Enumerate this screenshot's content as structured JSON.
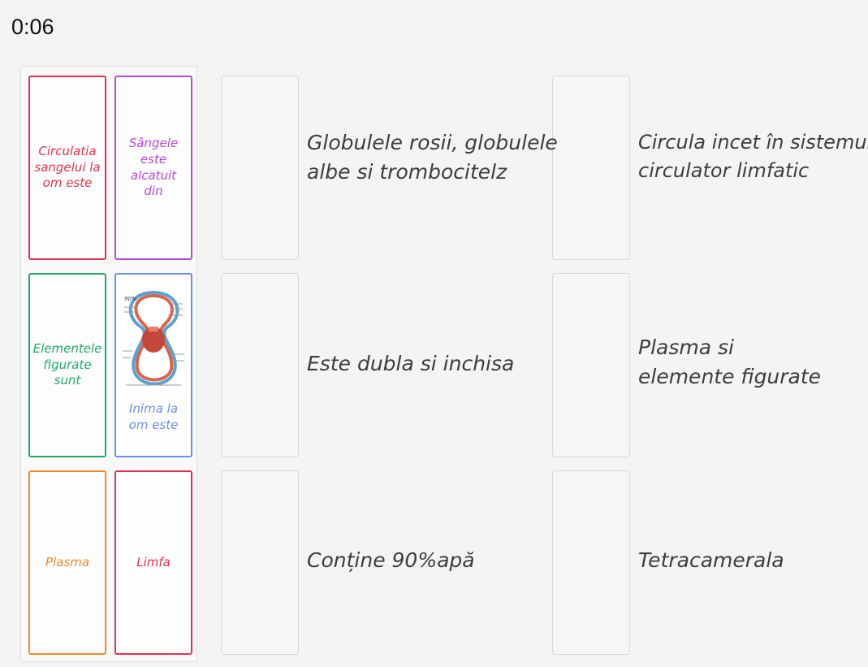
{
  "timer": "0:06",
  "cards": [
    {
      "label": "Circulatia sangelui la om este",
      "color": "#e0334f"
    },
    {
      "label": "Sângele este alcatuit din",
      "color": "#b54ad9"
    },
    {
      "label": "Elementele figurate sunt",
      "color": "#22a86b"
    },
    {
      "label": "Inima la om este",
      "color": "#6c8ee6",
      "image": "heart-circulation-diagram"
    },
    {
      "label": "Plasma",
      "color": "#f28a2c"
    },
    {
      "label": "Limfa",
      "color": "#e0334f"
    }
  ],
  "targets": [
    {
      "line1": "Globulele rosii, globulele",
      "line2": "albe si trombocitelz"
    },
    {
      "line1": "Circula incet în sistemul",
      "line2": "circulator limfatic"
    },
    {
      "line1": "Este dubla si inchisa",
      "line2": ""
    },
    {
      "line1": "Plasma si",
      "line2": "elemente figurate"
    },
    {
      "line1": "Conține 90%apă",
      "line2": ""
    },
    {
      "line1": "Tetracamerala",
      "line2": ""
    }
  ],
  "diagram_labels": {
    "percent": "90%"
  }
}
